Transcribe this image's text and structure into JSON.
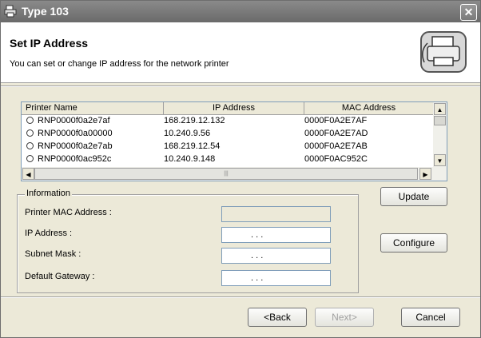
{
  "window": {
    "title": "Type 103",
    "close_glyph": "✕"
  },
  "header": {
    "title": "Set IP Address",
    "subtitle": "You can set or change IP address for the network printer",
    "logo_icon": "printer-network-icon"
  },
  "printer_list": {
    "columns": [
      "Printer Name",
      "IP Address",
      "MAC Address"
    ],
    "rows": [
      {
        "name": "RNP0000f0a2e7af",
        "ip": "168.219.12.132",
        "mac": "0000F0A2E7AF"
      },
      {
        "name": "RNP0000f0a00000",
        "ip": "10.240.9.56",
        "mac": "0000F0A2E7AD"
      },
      {
        "name": "RNP0000f0a2e7ab",
        "ip": "168.219.12.54",
        "mac": "0000F0A2E7AB"
      },
      {
        "name": "RNP0000f0ac952c",
        "ip": "10.240.9.148",
        "mac": "0000F0AC952C"
      }
    ]
  },
  "information": {
    "group_label": "Information",
    "mac_label": "Printer MAC Address :",
    "ip_label": "IP Address :",
    "subnet_label": "Subnet Mask :",
    "gateway_label": "Default Gateway :",
    "ip_placeholder_dots": ".        .        ."
  },
  "buttons": {
    "update": "Update",
    "configure": "Configure",
    "back": "<Back",
    "next": "Next>",
    "cancel": "Cancel"
  }
}
